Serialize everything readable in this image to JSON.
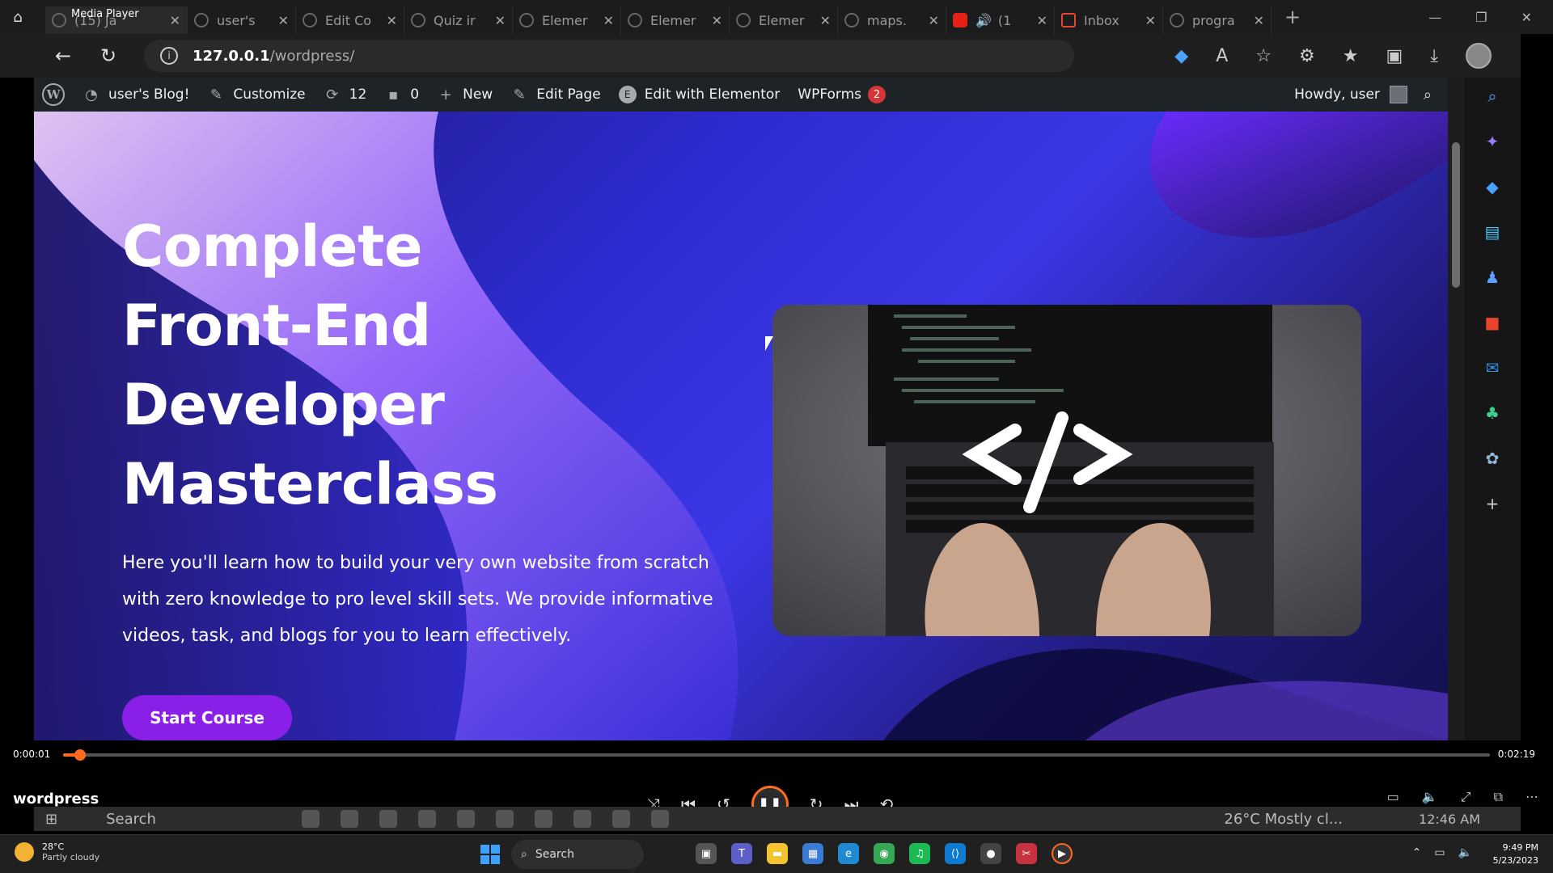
{
  "media_player": {
    "app_title": "Media Player",
    "time_elapsed": "0:00:01",
    "time_total": "0:02:19",
    "progress_fraction": 0.005,
    "media_title": "wordpress",
    "accent_color": "#ff6a1f"
  },
  "browser": {
    "tabs": [
      {
        "label": "(15) Ja",
        "icon": "media-icon"
      },
      {
        "label": "user's",
        "icon": "wordpress-icon"
      },
      {
        "label": "Edit Co",
        "icon": "wordpress-icon"
      },
      {
        "label": "Quiz ir",
        "icon": "wordpress-icon"
      },
      {
        "label": "Elemer",
        "icon": "wordpress-icon"
      },
      {
        "label": "Elemer",
        "icon": "wordpress-icon"
      },
      {
        "label": "Elemer",
        "icon": "wordpress-icon"
      },
      {
        "label": "maps.",
        "icon": "maps-icon"
      },
      {
        "label": "(1",
        "icon": "youtube-icon"
      },
      {
        "label": "Inbox",
        "icon": "gmail-icon"
      },
      {
        "label": "progra",
        "icon": "chrome-icon"
      }
    ],
    "url_host": "127.0.0.1",
    "url_path": "/wordpress/"
  },
  "wp_admin_bar": {
    "site_name": "user's Blog!",
    "customize": "Customize",
    "updates_count": "12",
    "comments_count": "0",
    "new": "New",
    "edit_page": "Edit Page",
    "edit_elementor": "Edit with Elementor",
    "wpforms": "WPForms",
    "wpforms_badge": "2",
    "howdy": "Howdy, user"
  },
  "hero": {
    "heading_lines": [
      "Complete",
      "Front-End",
      "Developer",
      "Masterclass"
    ],
    "description": "Here you'll learn how to build your very own website from scratch with zero knowledge to pro level skill sets. We provide informative videos, task, and blogs for you to learn effectively.",
    "cta_label": "Start Course",
    "image_overlay": "</>",
    "accent_color": "#8a1fe8"
  },
  "inner_taskbar": {
    "search": "Search",
    "weather": "26°C  Mostly cl...",
    "time": "12:46 AM"
  },
  "taskbar": {
    "weather_temp": "28°C",
    "weather_desc": "Partly cloudy",
    "search": "Search",
    "time": "9:49 PM",
    "date": "5/23/2023"
  }
}
